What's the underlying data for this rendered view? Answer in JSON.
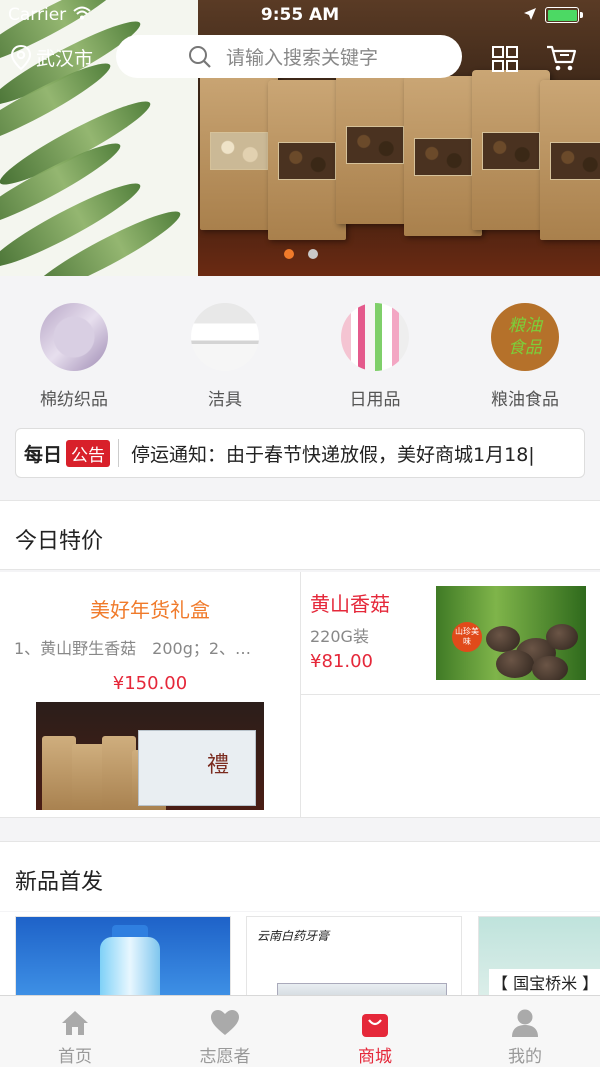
{
  "status_bar": {
    "carrier": "Carrier",
    "time": "9:55 AM"
  },
  "header": {
    "city": "武汉市",
    "search_placeholder": "请输入搜索关键字",
    "icons": [
      "location-pin-icon",
      "search-icon",
      "scan-grid-icon",
      "cart-icon"
    ]
  },
  "banner": {
    "page_count": 2,
    "active_index": 0
  },
  "categories": [
    {
      "label": "棉纺织品"
    },
    {
      "label": "洁具"
    },
    {
      "label": "日用品"
    },
    {
      "label": "粮油食品",
      "image_text": "粮油食品"
    }
  ],
  "notice": {
    "daily": "每日",
    "badge": "公告",
    "text": "停运通知：由于春节快递放假，美好商城1月18|"
  },
  "specials": {
    "title": "今日特价",
    "main": {
      "name": "美好年货礼盒",
      "desc": "1、黄山野生香菇　200g；2、…",
      "price": "¥150.00",
      "image_text": "禮"
    },
    "side": {
      "name": "黄山香菇",
      "spec": "220G装",
      "price": "¥81.00",
      "image_text": "山珍美味"
    }
  },
  "new_products": {
    "title": "新品首发",
    "items": [
      {
        "image_text": ""
      },
      {
        "image_text": "云南白药牙膏"
      },
      {
        "image_text": "【 国宝桥米 】"
      }
    ]
  },
  "tabbar": {
    "items": [
      {
        "label": "首页",
        "icon": "home-icon",
        "active": false
      },
      {
        "label": "志愿者",
        "icon": "heart-icon",
        "active": false
      },
      {
        "label": "商城",
        "icon": "shopping-bag-icon",
        "active": true
      },
      {
        "label": "我的",
        "icon": "person-icon",
        "active": false
      }
    ]
  },
  "colors": {
    "accent": "#e5283a",
    "orange": "#f07a2a",
    "active_dot": "#f07a2a"
  }
}
